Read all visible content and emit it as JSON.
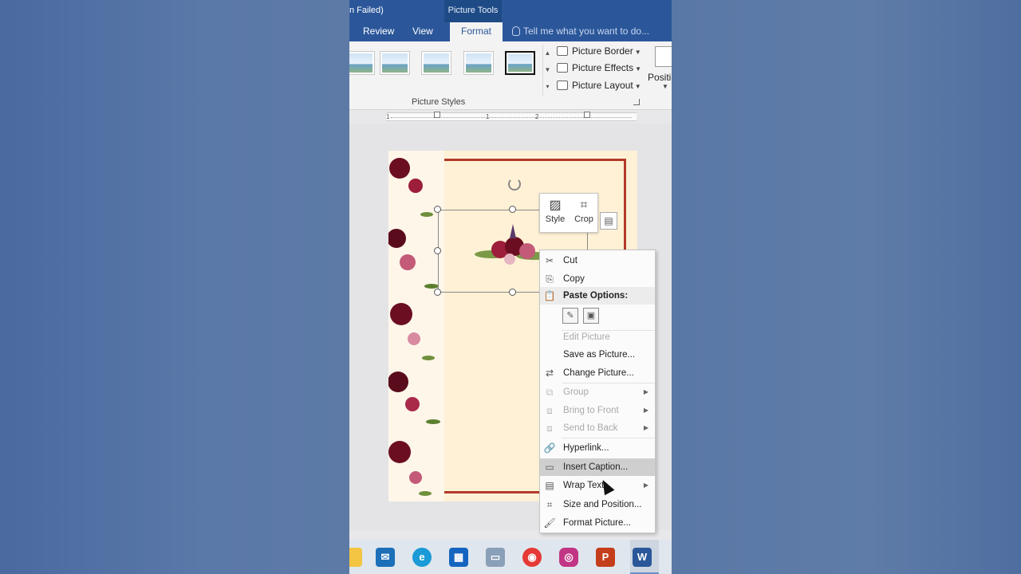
{
  "titlebar": {
    "title_fragment": "n Failed)",
    "context_tab": "Picture Tools"
  },
  "tabs": [
    {
      "label": "Review"
    },
    {
      "label": "View"
    },
    {
      "label": "Format"
    }
  ],
  "tell_me": {
    "placeholder": "Tell me what you want to do..."
  },
  "ribbon": {
    "picture_border": "Picture Border",
    "picture_effects": "Picture Effects",
    "picture_layout": "Picture Layout",
    "group_label": "Picture Styles",
    "position_label": "Positio"
  },
  "ruler": {
    "labels": [
      "1",
      "1",
      "2"
    ]
  },
  "minibar": {
    "style": "Style",
    "crop": "Crop"
  },
  "context_menu": {
    "cut": "Cut",
    "copy": "Copy",
    "paste_options": "Paste Options:",
    "edit_picture": "Edit Picture",
    "save_as_picture": "Save as Picture...",
    "change_picture": "Change Picture...",
    "group": "Group",
    "bring_to_front": "Bring to Front",
    "send_to_back": "Send to Back",
    "hyperlink": "Hyperlink...",
    "insert_caption": "Insert Caption...",
    "wrap_text": "Wrap Text",
    "size_and_position": "Size and Position...",
    "format_picture": "Format Picture..."
  },
  "taskbar": {
    "icons": [
      "file-explorer-icon",
      "mail-icon",
      "edge-icon",
      "store-icon",
      "remote-icon",
      "chrome-icon",
      "instagram-icon",
      "powerpoint-icon",
      "word-icon"
    ]
  },
  "colors": {
    "ribbon_blue": "#2b579a",
    "page_background": "#fff1d5",
    "frame_red": "#b23a2a",
    "menu_highlight": "#cfcfcf"
  }
}
